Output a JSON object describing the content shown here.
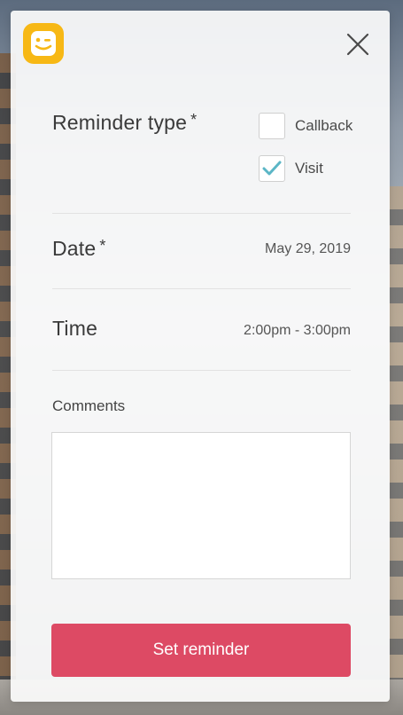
{
  "brand": {
    "logo_icon": "smiley-wink-icon",
    "accent_color": "#f7b815"
  },
  "close_icon": "close-icon",
  "reminder_type": {
    "label": "Reminder type",
    "required_mark": "*",
    "options": [
      {
        "label": "Callback",
        "checked": false
      },
      {
        "label": "Visit",
        "checked": true
      }
    ],
    "check_color": "#5bb6c6"
  },
  "date": {
    "label": "Date",
    "required_mark": "*",
    "value": "May 29, 2019"
  },
  "time": {
    "label": "Time",
    "value": "2:00pm - 3:00pm"
  },
  "comments": {
    "label": "Comments",
    "value": ""
  },
  "submit": {
    "label": "Set reminder",
    "color": "#dd4a64"
  }
}
